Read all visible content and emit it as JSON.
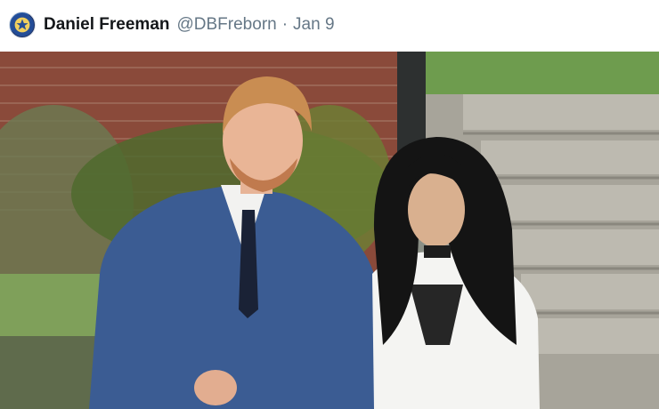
{
  "tweet": {
    "author_name": "Daniel Freeman",
    "handle": "@DBFreborn",
    "separator": "·",
    "date": "Jan 9"
  },
  "media": {
    "type": "photo",
    "description_icon": "photo-icon"
  }
}
